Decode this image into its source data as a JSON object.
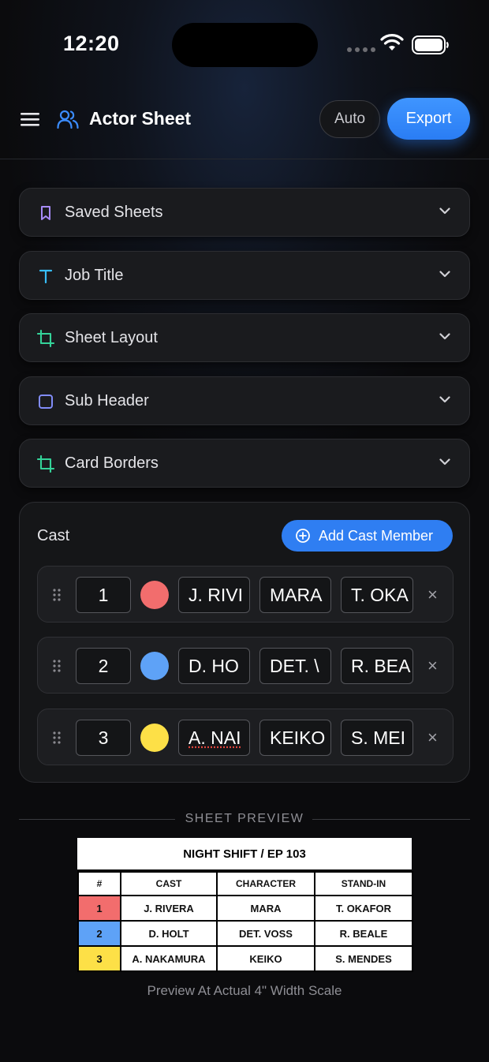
{
  "status": {
    "time": "12:20"
  },
  "header": {
    "title": "Actor Sheet",
    "auto_label": "Auto",
    "export_label": "Export"
  },
  "sections": [
    {
      "label": "Saved Sheets",
      "icon": "bookmark-icon",
      "color": "#a78bfa"
    },
    {
      "label": "Job Title",
      "icon": "text-t-icon",
      "color": "#38bdf8"
    },
    {
      "label": "Sheet Layout",
      "icon": "crop-icon",
      "color": "#34d399"
    },
    {
      "label": "Sub Header",
      "icon": "square-icon",
      "color": "#818cf8"
    },
    {
      "label": "Card Borders",
      "icon": "crop-icon",
      "color": "#34d399"
    }
  ],
  "cast": {
    "title": "Cast",
    "add_label": "Add Cast Member",
    "rows": [
      {
        "num": "1",
        "color": "#f26d6d",
        "cast": "J. RIVI",
        "character": "MARA",
        "standin": "T. OKA"
      },
      {
        "num": "2",
        "color": "#5ea2f7",
        "cast": "D. HO",
        "character": "DET. \\",
        "standin": "R. BEA"
      },
      {
        "num": "3",
        "color": "#fde047",
        "cast": "A. NAI",
        "character": "KEIKO",
        "standin": "S. MEI"
      }
    ],
    "remove_symbol": "×"
  },
  "preview": {
    "label": "SHEET PREVIEW",
    "sheet_title": "NIGHT SHIFT / EP 103",
    "headers": [
      "#",
      "CAST",
      "CHARACTER",
      "STAND-IN"
    ],
    "rows": [
      {
        "num": "1",
        "color": "#f26d6d",
        "cast": "J. RIVERA",
        "character": "MARA",
        "standin": "T. OKAFOR"
      },
      {
        "num": "2",
        "color": "#5ea2f7",
        "cast": "D. HOLT",
        "character": "DET. VOSS",
        "standin": "R. BEALE"
      },
      {
        "num": "3",
        "color": "#fde047",
        "cast": "A. NAKAMURA",
        "character": "KEIKO",
        "standin": "S. MENDES"
      }
    ],
    "caption": "Preview At Actual 4\" Width Scale"
  }
}
